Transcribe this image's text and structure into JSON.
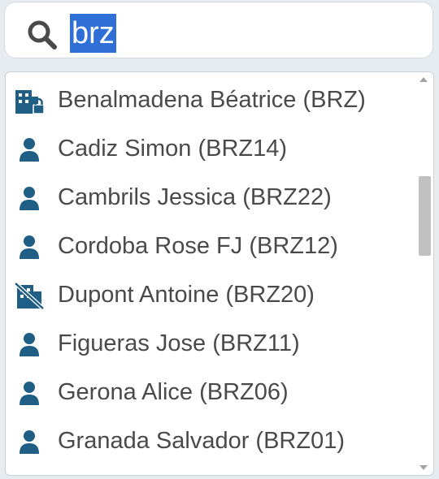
{
  "search": {
    "query": "brz"
  },
  "results": [
    {
      "label": "Benalmadena Béatrice (BRZ)",
      "icon": "building-lock-icon"
    },
    {
      "label": "Cadiz Simon (BRZ14)",
      "icon": "user-icon"
    },
    {
      "label": "Cambrils Jessica (BRZ22)",
      "icon": "user-icon"
    },
    {
      "label": "Cordoba Rose FJ (BRZ12)",
      "icon": "user-icon"
    },
    {
      "label": "Dupont Antoine (BRZ20)",
      "icon": "building-off-icon"
    },
    {
      "label": "Figueras Jose (BRZ11)",
      "icon": "user-icon"
    },
    {
      "label": "Gerona Alice (BRZ06)",
      "icon": "user-icon"
    },
    {
      "label": "Granada Salvador (BRZ01)",
      "icon": "user-icon"
    }
  ],
  "colors": {
    "icon": "#1f5f85",
    "text": "#4a4a4a",
    "selection": "#2f6fd6"
  }
}
